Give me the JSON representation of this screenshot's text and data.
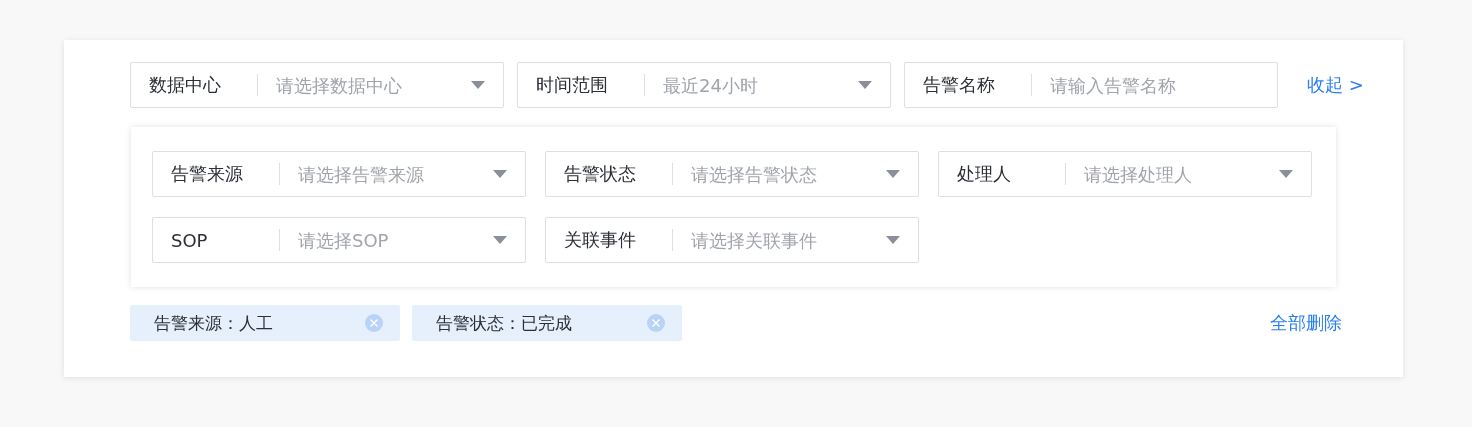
{
  "filters": [
    {
      "kind": "select",
      "label": "数据中心",
      "placeholder": "请选择数据中心"
    },
    {
      "kind": "select",
      "label": "时间范围",
      "placeholder": "最近24小时"
    },
    {
      "kind": "input",
      "label": "告警名称",
      "placeholder": "请输入告警名称"
    }
  ],
  "collapse_link": "收起 >",
  "more_filters": [
    {
      "kind": "select",
      "label": "告警来源",
      "placeholder": "请选择告警来源"
    },
    {
      "kind": "select",
      "label": "告警状态",
      "placeholder": "请选择告警状态"
    },
    {
      "kind": "select",
      "label": "处理人",
      "placeholder": "请选择处理人"
    },
    {
      "kind": "select",
      "label": "SOP",
      "placeholder": "请选择SOP"
    },
    {
      "kind": "select",
      "label": "关联事件",
      "placeholder": "请选择关联事件"
    }
  ],
  "tags": [
    {
      "text": "告警来源：人工"
    },
    {
      "text": "告警状态：已完成"
    }
  ],
  "clear_all": "全部删除"
}
